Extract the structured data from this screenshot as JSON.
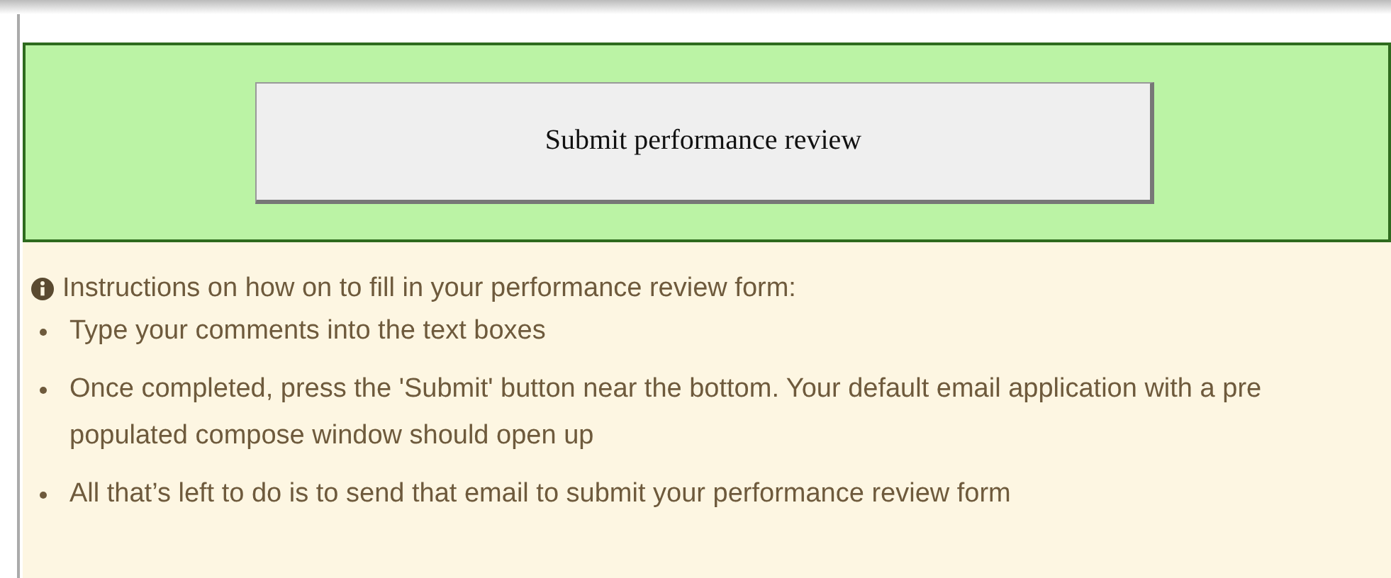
{
  "submit_button": {
    "label": "Submit performance review"
  },
  "instructions": {
    "heading": "Instructions on how on to fill in your performance review form:",
    "items": [
      "Type your comments into the text boxes",
      "Once completed, press the 'Submit' button near the bottom. Your default email application with a pre populated compose window should open up",
      "All that’s left to do is to send that email to submit your performance review form"
    ]
  }
}
